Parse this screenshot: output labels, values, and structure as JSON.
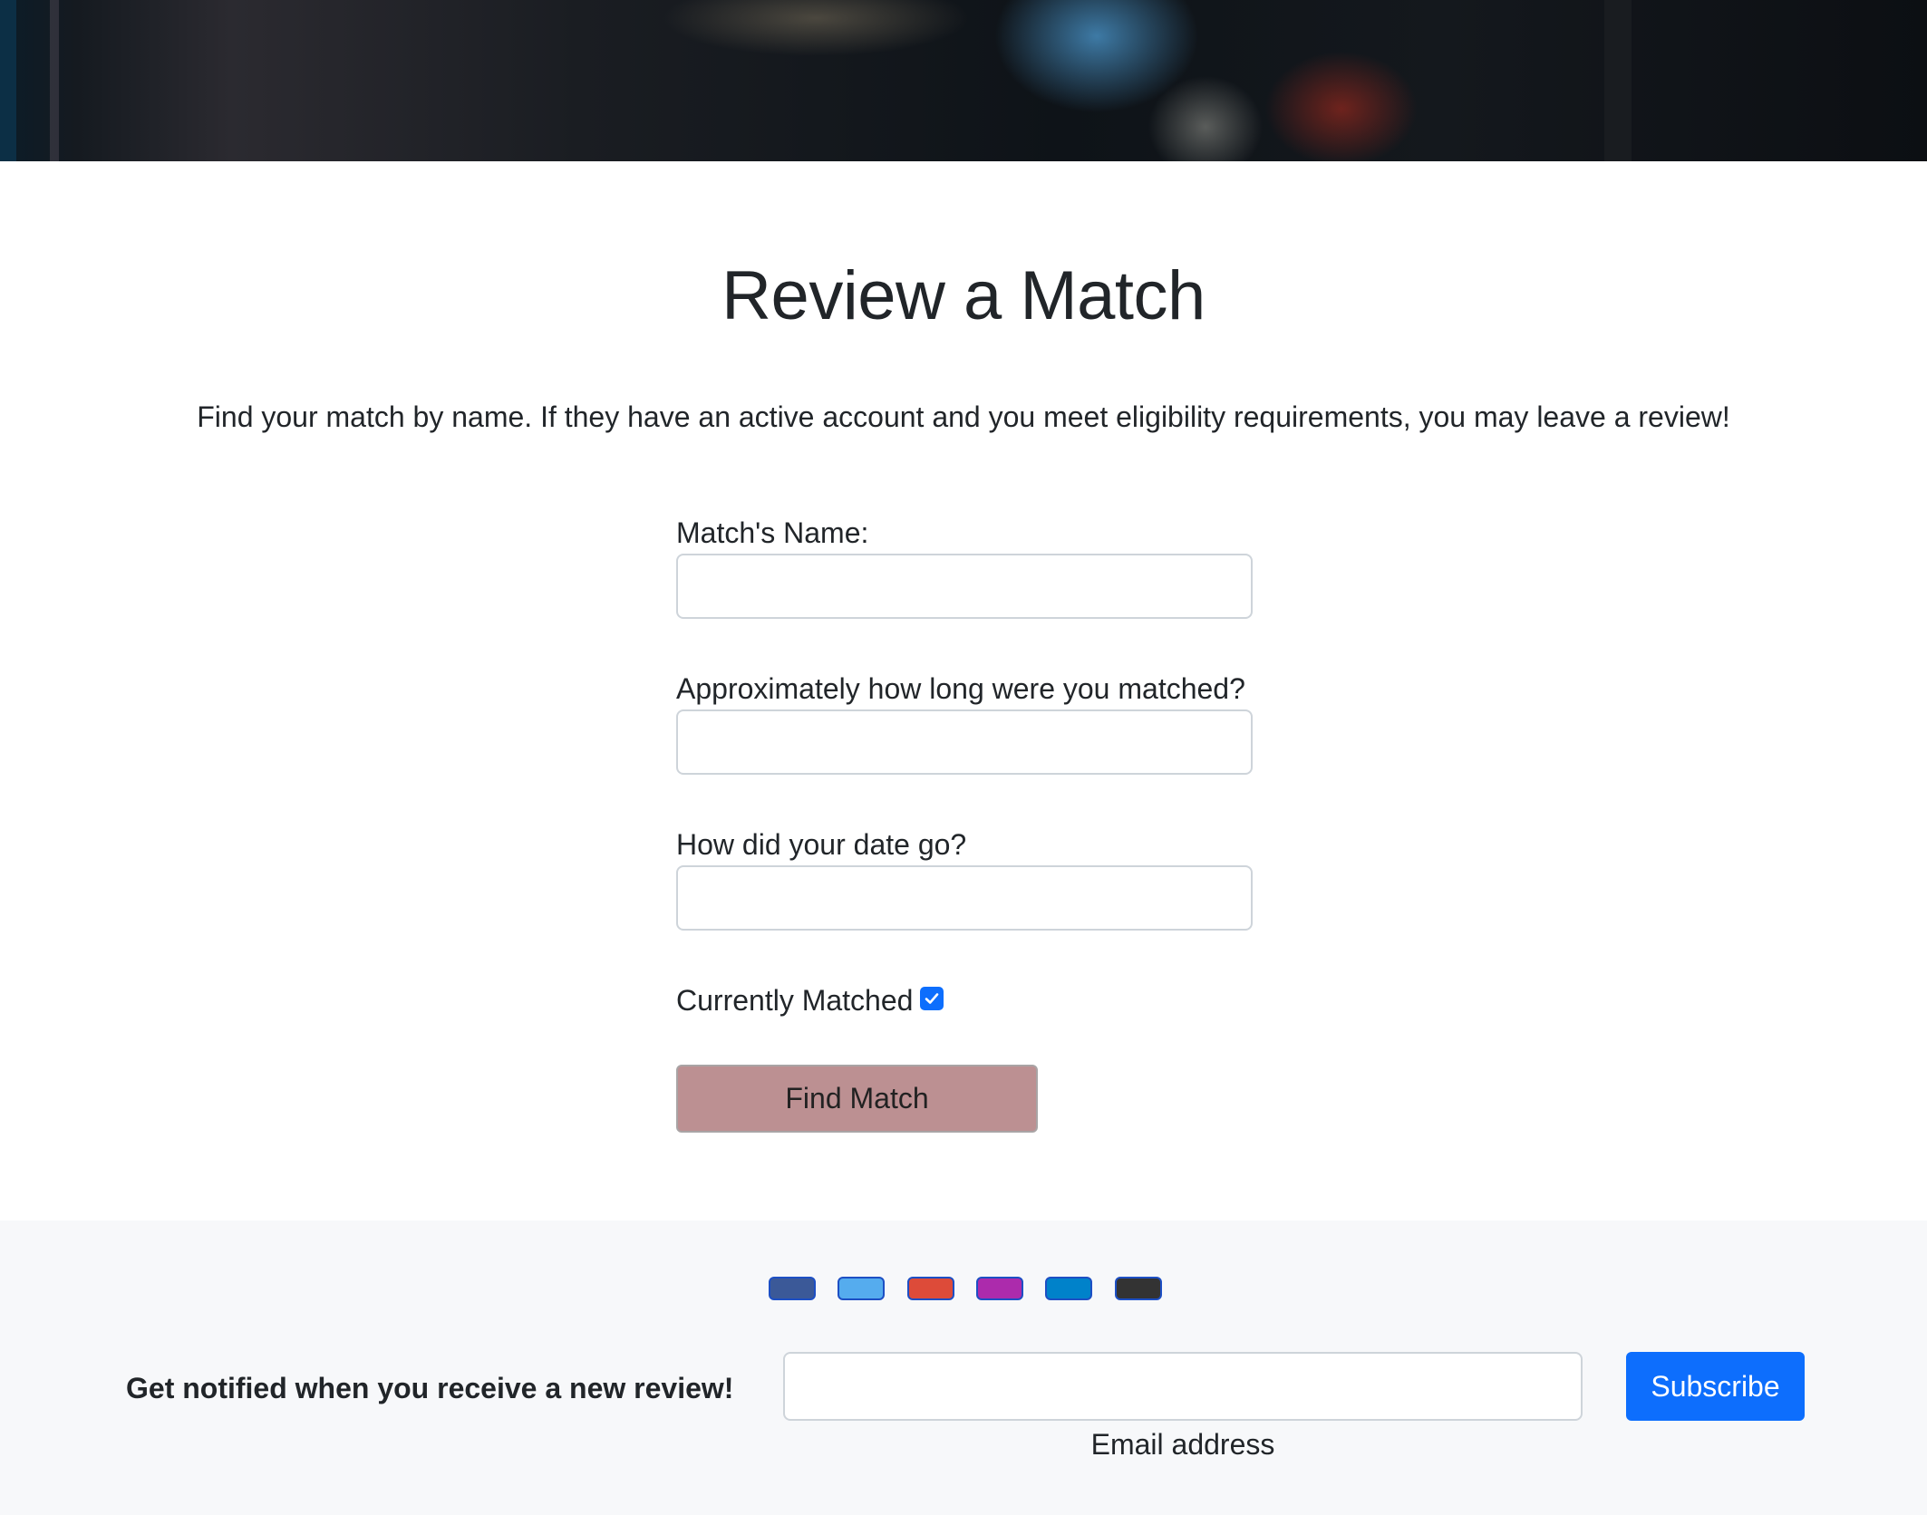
{
  "page": {
    "title": "Review a Match",
    "intro": "Find your match by name. If they have an active account and you meet eligibility requirements, you may leave a review!"
  },
  "form": {
    "name_label": "Match's Name:",
    "name_value": "",
    "duration_label": "Approximately how long were you matched?",
    "duration_value": "",
    "date_label": "How did your date go?",
    "date_value": "",
    "currently_matched_label": "Currently Matched",
    "currently_matched_checked": true,
    "submit_label": "Find Match"
  },
  "footer": {
    "social_icons": [
      {
        "name": "facebook-icon",
        "color": "#3b5998"
      },
      {
        "name": "twitter-icon",
        "color": "#55acee"
      },
      {
        "name": "google-icon",
        "color": "#dd4b39"
      },
      {
        "name": "instagram-icon",
        "color": "#ac2bac"
      },
      {
        "name": "linkedin-icon",
        "color": "#0082ca"
      },
      {
        "name": "github-icon",
        "color": "#333333"
      }
    ],
    "notify_text": "Get notified when you receive a new review!",
    "email_value": "",
    "email_help": "Email address",
    "subscribe_label": "Subscribe"
  },
  "colors": {
    "find_button": "#bc9092",
    "primary": "#0d6efd",
    "footer_bg": "#f7f8fa"
  }
}
